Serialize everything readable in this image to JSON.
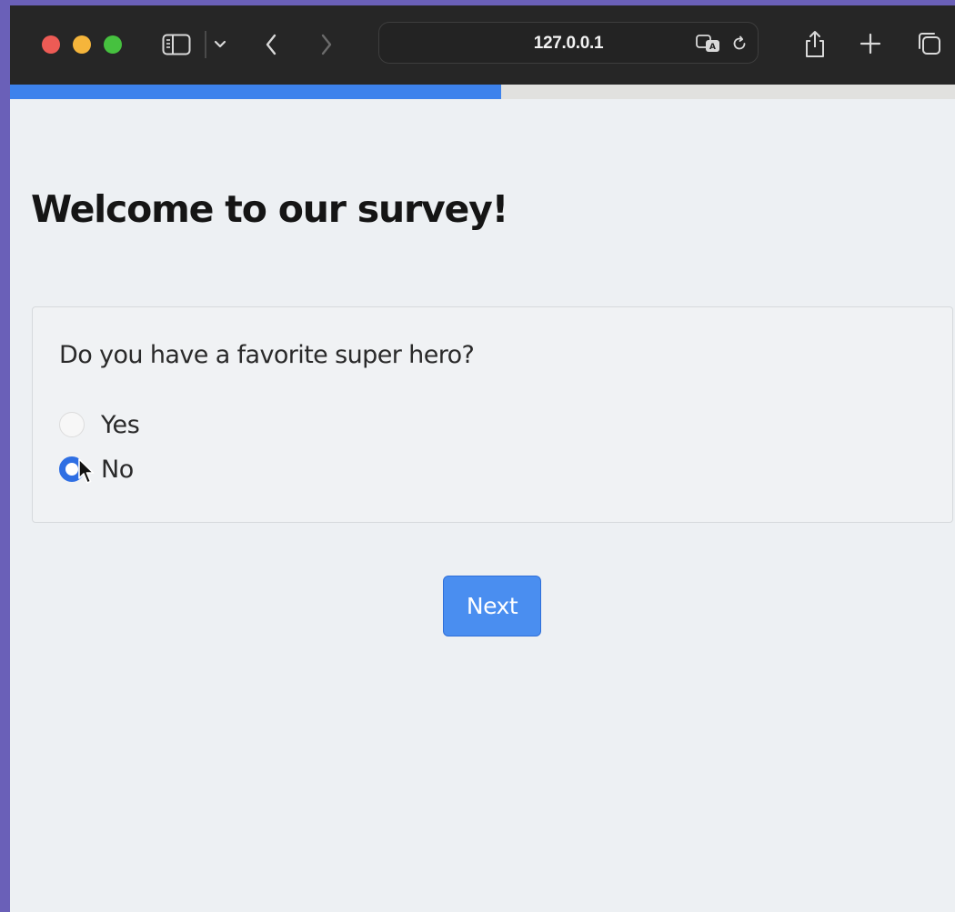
{
  "browser": {
    "url": "127.0.0.1",
    "icons": [
      "close-dot",
      "minimize-dot",
      "zoom-dot",
      "sidebar-icon",
      "chevron-down-icon",
      "back-icon",
      "forward-icon",
      "translate-icon",
      "reload-icon",
      "share-icon",
      "new-tab-icon",
      "tabs-overview-icon"
    ]
  },
  "survey": {
    "progress": 0.52,
    "title": "Welcome to our survey!",
    "question": "Do you have a favorite super hero?",
    "options": [
      {
        "label": "Yes",
        "selected": false
      },
      {
        "label": "No",
        "selected": true
      }
    ],
    "next_label": "Next"
  },
  "colors": {
    "accent": "#3d82ec",
    "button": "#4a8ef0",
    "traffic_red": "#ed5b55",
    "traffic_yellow": "#f5b53b",
    "traffic_green": "#46c13f"
  }
}
